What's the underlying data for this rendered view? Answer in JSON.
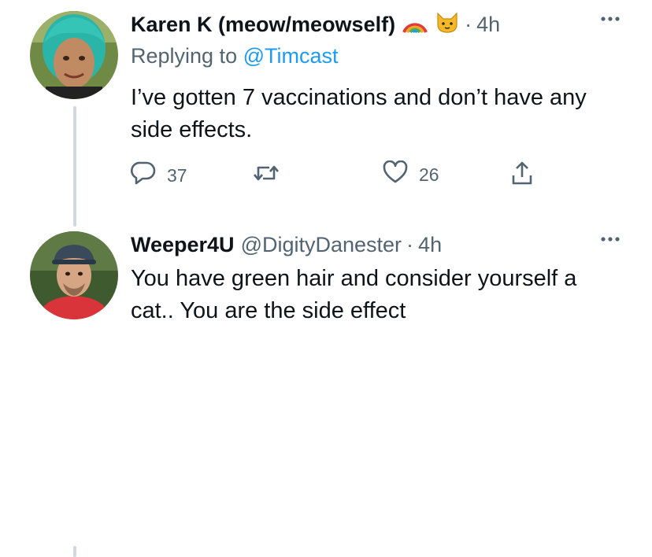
{
  "tweets": [
    {
      "author_name": "Karen K (meow/meowself)",
      "name_badges": [
        "rainbow-emoji",
        "cat-face-emoji"
      ],
      "separator": "·",
      "time": "4h",
      "replying_prefix": "Replying to",
      "replying_to": "@Timcast",
      "text": "I’ve gotten 7 vaccinations and don’t have any side effects.",
      "actions": {
        "reply_count": "37",
        "like_count": "26"
      }
    },
    {
      "author_name": "Weeper4U",
      "handle": "@DigityDanester",
      "separator": "·",
      "time": "4h",
      "text": "You have green hair and consider yourself a cat.. You are the side effect"
    }
  ],
  "colors": {
    "text": "#0f1419",
    "secondary": "#536471",
    "link": "#1d9bf0",
    "thread_line": "#cfd9de"
  },
  "icons": [
    "more-icon",
    "reply-icon",
    "retweet-icon",
    "like-icon",
    "share-icon"
  ]
}
